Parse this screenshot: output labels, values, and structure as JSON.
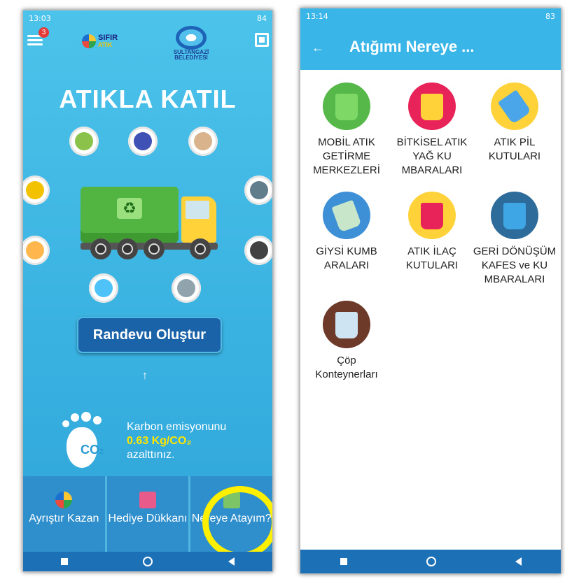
{
  "left_phone": {
    "status_time": "13:03",
    "battery": "84",
    "notification_count": "3",
    "brand_name_1": "SIFIR",
    "brand_name_2": "ATIK",
    "municipality_1": "SULTANGAZİ",
    "municipality_2": "BELEDİYESİ",
    "hero_title": "ATIKLA KATIL",
    "appointment_button": "Randevu Oluştur",
    "carbon_line1": "Karbon emisyonunu",
    "carbon_value": "0.63 Kg/CO₂",
    "carbon_line3": "azalttınız.",
    "co2_label": "CO",
    "co2_sub": "2",
    "nav": [
      {
        "label": "Ayrıştır Kazan",
        "icon": "recycle-globe-icon"
      },
      {
        "label": "Hediye Dükkanı",
        "icon": "gift-icon"
      },
      {
        "label": "Nereye Atayım?",
        "icon": "map-icon"
      }
    ],
    "highlight_color": "#ffef00"
  },
  "right_phone": {
    "status_time": "13:14",
    "battery": "83",
    "title": "Atığımı Nereye ...",
    "categories": [
      {
        "label": "MOBİL ATIK GETİRME MERKEZLERİ",
        "icon": "mobile-waste-center-icon"
      },
      {
        "label": "BİTKİSEL ATIK YAĞ KU MBARALARI",
        "icon": "vegetable-oil-bin-icon"
      },
      {
        "label": "ATIK PİL KUTULARI",
        "icon": "battery-bin-icon"
      },
      {
        "label": "GİYSİ KUMB ARALARI",
        "icon": "clothes-bin-icon"
      },
      {
        "label": "ATIK İLAÇ KUTULARI",
        "icon": "medicine-bin-icon"
      },
      {
        "label": "GERİ DÖNÜŞÜM KAFES ve KU MBARALARI",
        "icon": "recycling-cage-icon"
      },
      {
        "label": "Çöp Konteynerları",
        "icon": "trash-container-icon"
      }
    ],
    "accent_color": "#3ab5e8"
  }
}
